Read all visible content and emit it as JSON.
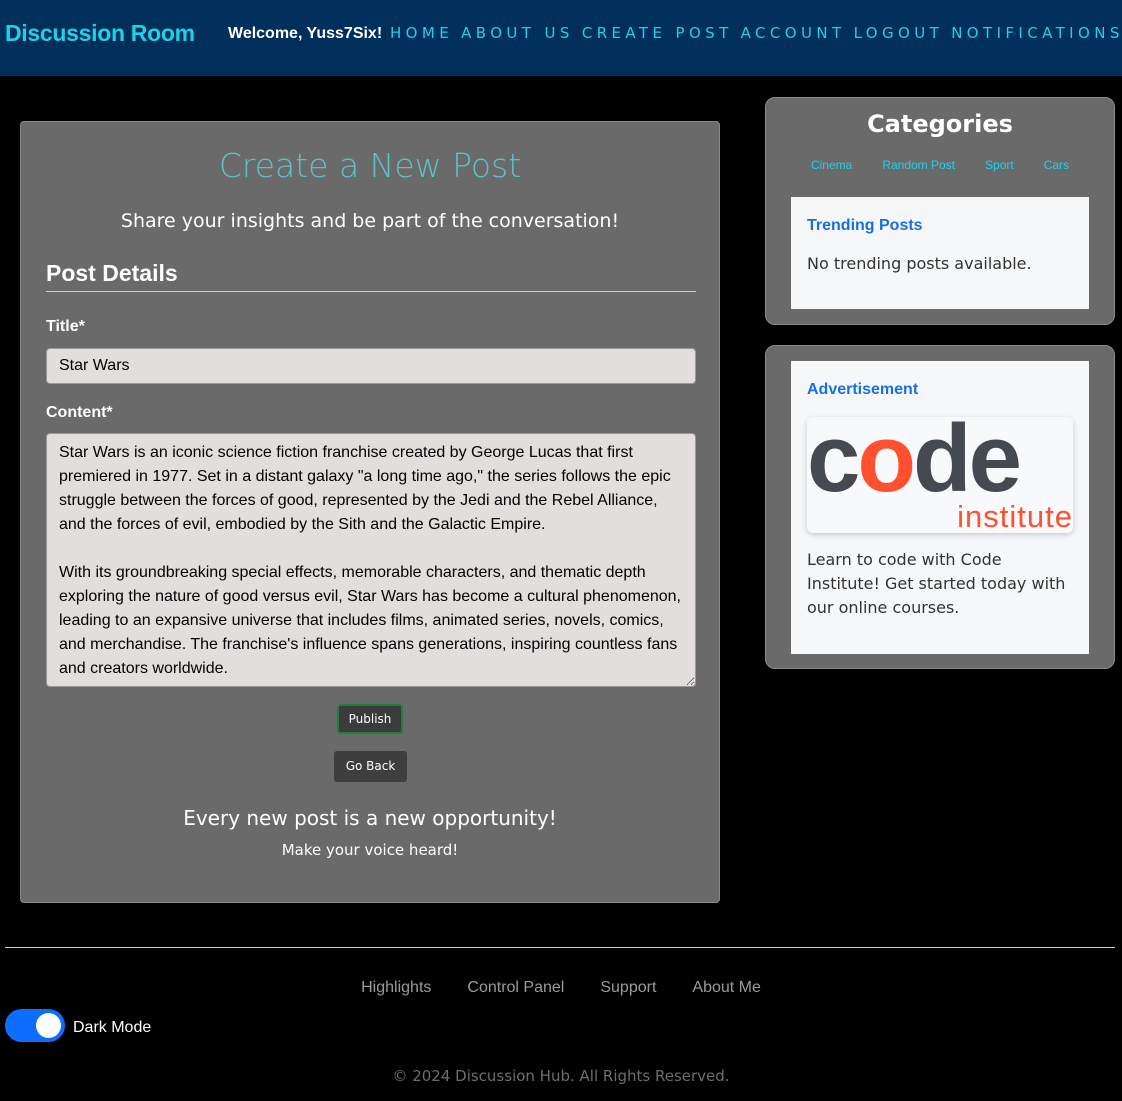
{
  "header": {
    "brand": "Discussion Room",
    "welcome": "Welcome, Yuss7Six!",
    "nav": [
      "HOME",
      "ABOUT US",
      "CREATE POST",
      "ACCOUNT",
      "LOGOUT",
      "NOTIFICATIONS"
    ]
  },
  "post_form": {
    "title": "Create a New Post",
    "lead": "Share your insights and be part of the conversation!",
    "section_heading": "Post Details",
    "title_label": "Title*",
    "title_value": "Star Wars",
    "content_label": "Content*",
    "content_value": "Star Wars is an iconic science fiction franchise created by George Lucas that first premiered in 1977. Set in a distant galaxy \"a long time ago,\" the series follows the epic struggle between the forces of good, represented by the Jedi and the Rebel Alliance, and the forces of evil, embodied by the Sith and the Galactic Empire.\n\nWith its groundbreaking special effects, memorable characters, and thematic depth exploring the nature of good versus evil, Star Wars has become a cultural phenomenon, leading to an expansive universe that includes films, animated series, novels, comics, and merchandise. The franchise's influence spans generations, inspiring countless fans and creators worldwide.",
    "publish_label": "Publish",
    "back_label": "Go Back",
    "tagline": "Every new post is a new opportunity!",
    "subtagline": "Make your voice heard!"
  },
  "sidebar": {
    "categories_title": "Categories",
    "categories": [
      "Cinema",
      "Random Post",
      "Sport",
      "Cars"
    ],
    "trending_title": "Trending Posts",
    "trending_empty": "No trending posts available.",
    "ad_title": "Advertisement",
    "ad_logo": {
      "word_c": "c",
      "word_o": "o",
      "word_d": "d",
      "word_e": "e",
      "sub": "institute"
    },
    "ad_text": "Learn to code with Code Institute! Get started today with our online courses."
  },
  "footer": {
    "links": [
      "Highlights",
      "Control Panel",
      "Support",
      "About Me"
    ],
    "dark_mode_label": "Dark Mode",
    "dark_mode_on": true,
    "copyright": "© 2024 Discussion Hub. All Rights Reserved."
  },
  "colors": {
    "navbar": "#002f5c",
    "accent_cyan": "#1fd1e6",
    "card_gray": "#6b6a6b",
    "link_blue": "#1a6fe0",
    "toggle_blue": "#0d6efd"
  }
}
